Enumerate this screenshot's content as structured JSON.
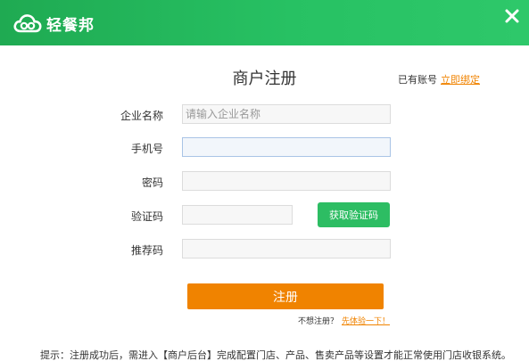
{
  "titlebar": {
    "brand_name": "轻餐邦",
    "brand_color": "#27c163",
    "icons": [
      "cloud-logo-icon",
      "close-icon"
    ]
  },
  "header": {
    "title": "商户注册",
    "have_account_text": "已有账号",
    "bind_link": "立即绑定"
  },
  "form": {
    "company": {
      "label": "企业名称",
      "placeholder": "请输入企业名称",
      "value": ""
    },
    "phone": {
      "label": "手机号",
      "value": ""
    },
    "password": {
      "label": "密码",
      "value": ""
    },
    "code": {
      "label": "验证码",
      "value": "",
      "button": "获取验证码"
    },
    "referrer": {
      "label": "推荐码",
      "value": ""
    },
    "submit": "注册",
    "accent_color": "#f08300",
    "button_green": "#2dbd63"
  },
  "trial": {
    "text": "不想注册？",
    "link": "先体验一下！"
  },
  "tip": "提示：注册成功后，需进入【商户后台】完成配置门店、产品、售卖产品等设置才能正常使用门店收银系统。"
}
